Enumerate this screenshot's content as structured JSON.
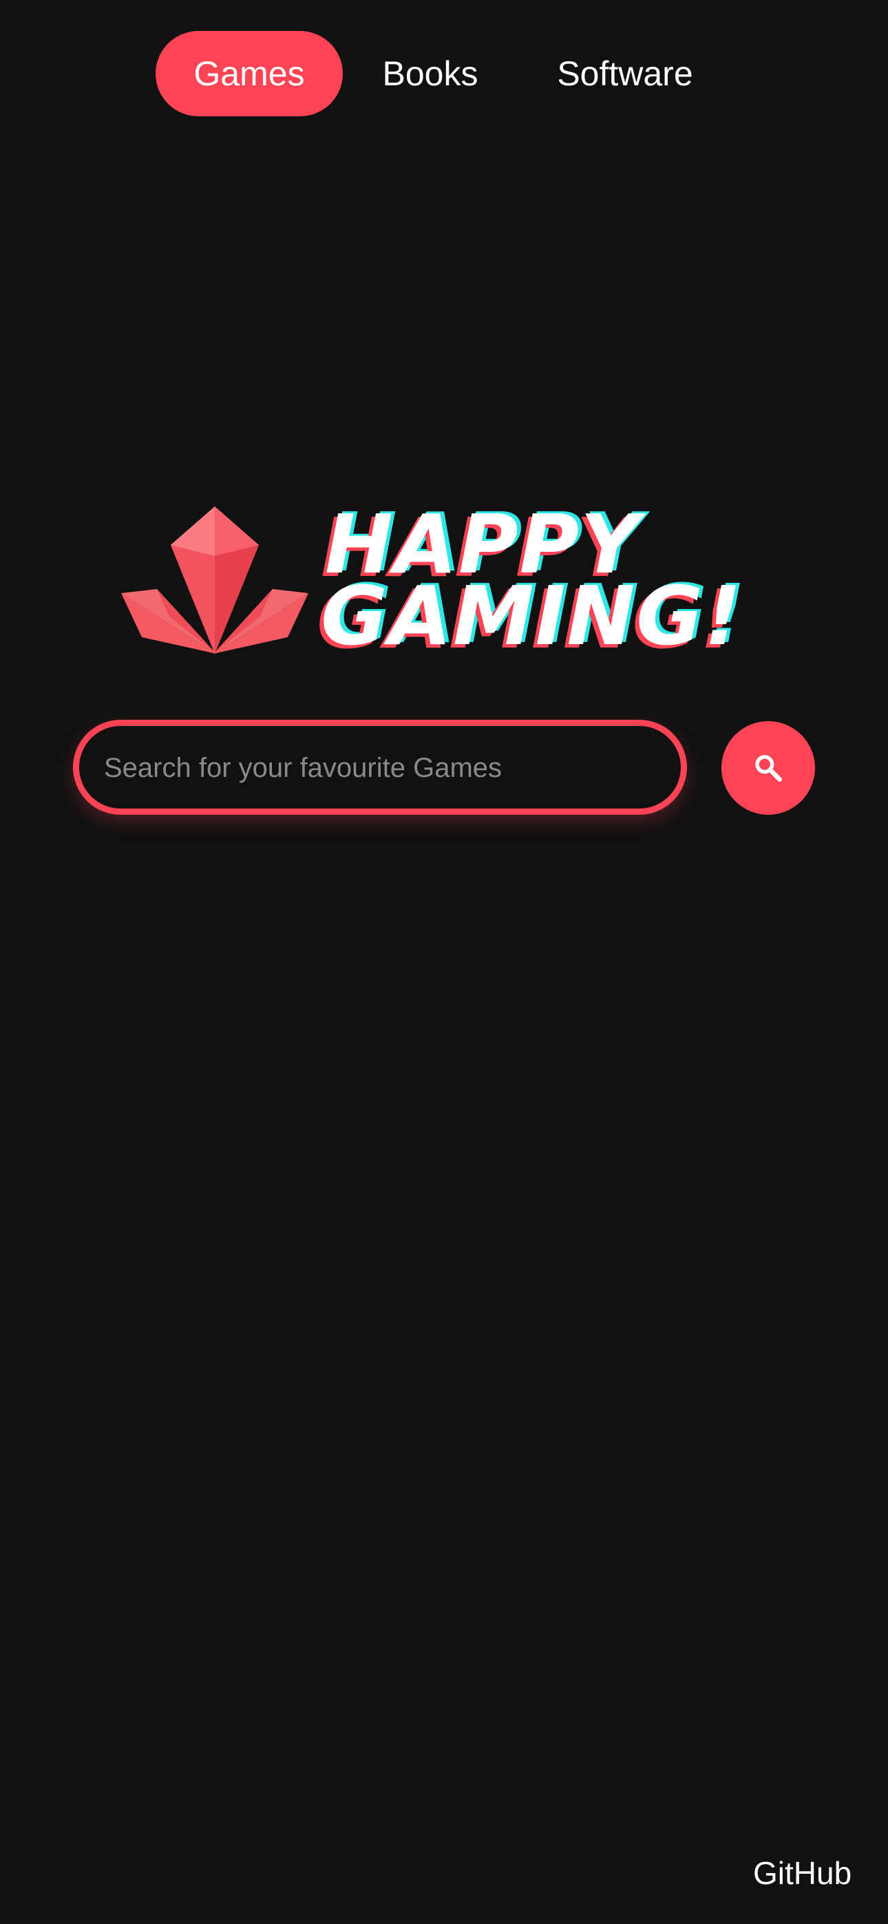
{
  "nav": {
    "tabs": [
      {
        "label": "Games",
        "active": true
      },
      {
        "label": "Books",
        "active": false
      },
      {
        "label": "Software",
        "active": false
      }
    ]
  },
  "logo": {
    "icon": "crystal-logo-icon",
    "wordmark_line1": "HAPPY",
    "wordmark_line2": "GAMING!"
  },
  "search": {
    "placeholder": "Search for your favourite Games",
    "value": "",
    "button_icon": "search-icon"
  },
  "footer": {
    "github_label": "GitHub"
  },
  "colors": {
    "background": "#111111",
    "accent": "#fc4454",
    "text": "#ffffff",
    "placeholder": "#8a8a8a",
    "wordmark_shadow_cyan": "#2ee6e6"
  }
}
